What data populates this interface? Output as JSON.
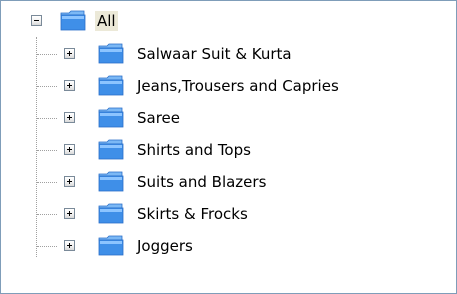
{
  "tree": {
    "root": {
      "label": "All",
      "expander": "collapse",
      "icon": "folder-icon"
    },
    "children": [
      {
        "label": "Salwaar Suit & Kurta",
        "expander": "expand",
        "icon": "folder-icon"
      },
      {
        "label": "Jeans,Trousers and Capries",
        "expander": "expand",
        "icon": "folder-icon"
      },
      {
        "label": "Saree",
        "expander": "expand",
        "icon": "folder-icon"
      },
      {
        "label": "Shirts and Tops",
        "expander": "expand",
        "icon": "folder-icon"
      },
      {
        "label": "Suits and Blazers",
        "expander": "expand",
        "icon": "folder-icon"
      },
      {
        "label": "Skirts & Frocks",
        "expander": "expand",
        "icon": "folder-icon"
      },
      {
        "label": "Joggers",
        "expander": "expand",
        "icon": "folder-icon"
      }
    ]
  },
  "colors": {
    "folder_body": "#3f8fe8",
    "folder_tab": "#7bb8f5",
    "selected_bg": "#ece9d8",
    "border": "#7f9db9"
  }
}
